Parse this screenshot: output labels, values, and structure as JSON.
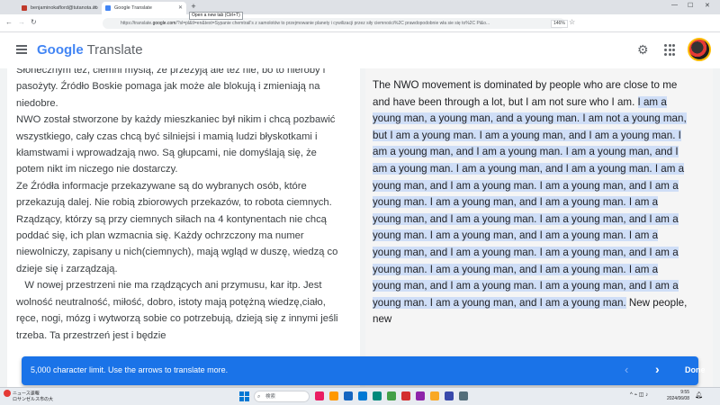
{
  "browser": {
    "tabs": [
      {
        "title": "benjaminokaflord@tutanota.co",
        "fav_color": "#c0392b"
      },
      {
        "title": "Google Translate",
        "fav_color": "#4285f4"
      }
    ],
    "new_tab_tooltip": "Open a new tab (Ctrl+T)",
    "url_prefix": "https://translate.",
    "url_host": "google.com",
    "url_rest": "/?sl=pl&tl=en&text=Sypanie chemtrail's z samolotów to przejmowanie planety i cywilizacji przez siły ciemności%2C prawdopodobnie wła sie się to%2C Pi&o...",
    "zoom": "146%"
  },
  "app": {
    "logo_google": "Google",
    "logo_translate": " Translate"
  },
  "source": {
    "paragraphs": [
      "Słonecznym też, ciemni myślą, że przeżyją ale też nie, bo to nieroby i pasożyty. Źródło Boskie pomaga jak może ale blokują i zmieniają na niedobre.",
      "NWO został stworzone by  każdy mieszkaniec  był nikim i  chcą pozbawić  wszystkiego, cały czas chcą być silniejsi i mamią ludzi błyskotkami i kłamstwami i wprowadzają nwo. Są głupcami, nie domyślają się, że  potem nikt im niczego nie dostarczy.",
      "Ze Źródła informacje przekazywane są do wybranych osób, które przekazują dalej. Nie robią zbiorowych przekazów, to robota ciemnych.",
      "Rządzący, którzy są  przy ciemnych siłach na 4 kontynentach nie chcą poddać się, ich plan wzmacnia się. Każdy ochrzczony ma numer niewolniczy, zapisany u nich(ciemnych), mają wgląd w duszę, wiedzą co dzieje się i zarządzają.",
      "   W nowej przestrzeni nie ma rządzących ani przymusu, kar itp. Jest wolność neutralność, miłość, dobro, istoty mają potężną wiedzę,ciało, ręce, nogi, mózg i wytworzą sobie co potrzebują, dzieją się z innymi jeśli trzeba. Ta przestrzeń jest i będzie"
    ]
  },
  "target": {
    "intro": "The NWO movement is dominated by people who are close to me and have been through a lot, but I am not sure who I am. ",
    "highlighted": "I am a young man, a young man, and a young man. I am not a young man, but I am a young man. I am a young man, and I am a young man. I am a young man, and I am a young man. I am a young man, and I am a young man. I am a young man, and I am a young man. I am a young man, and I am a young man. I am a young man, and I am a young man. I am a young man, and I am a young man. I am a young man, and I am a young man. I am a young man, and I am a young man. I am a young man, and I am a young man. I am a young man, and I am a young man. I am a young man, and I am a young man. I am a young man, and I am a young man. I am a young man, and I am a young man. I am a young man, and I am a young man. I am a young man, and I am a young man.",
    "outro": " New people, new"
  },
  "snackbar": {
    "message": "5,000 character limit. Use the arrows to translate more.",
    "prev": "‹",
    "next": "›",
    "done": "Done"
  },
  "taskbar": {
    "weather_line1": "ニュース速報",
    "weather_line2": "ロサンゼルス市の大",
    "search_placeholder": "検索",
    "time": "9:55",
    "date": "2024/06/08",
    "tray_icons": "^ ⌁ ◫ ♪",
    "icon_colors": [
      "#e91e63",
      "#ff9800",
      "#1565c0",
      "#0078d4",
      "#00897b",
      "#43a047",
      "#d32f2f",
      "#8e24aa",
      "#f9a825",
      "#3949ab",
      "#546e7a"
    ]
  }
}
